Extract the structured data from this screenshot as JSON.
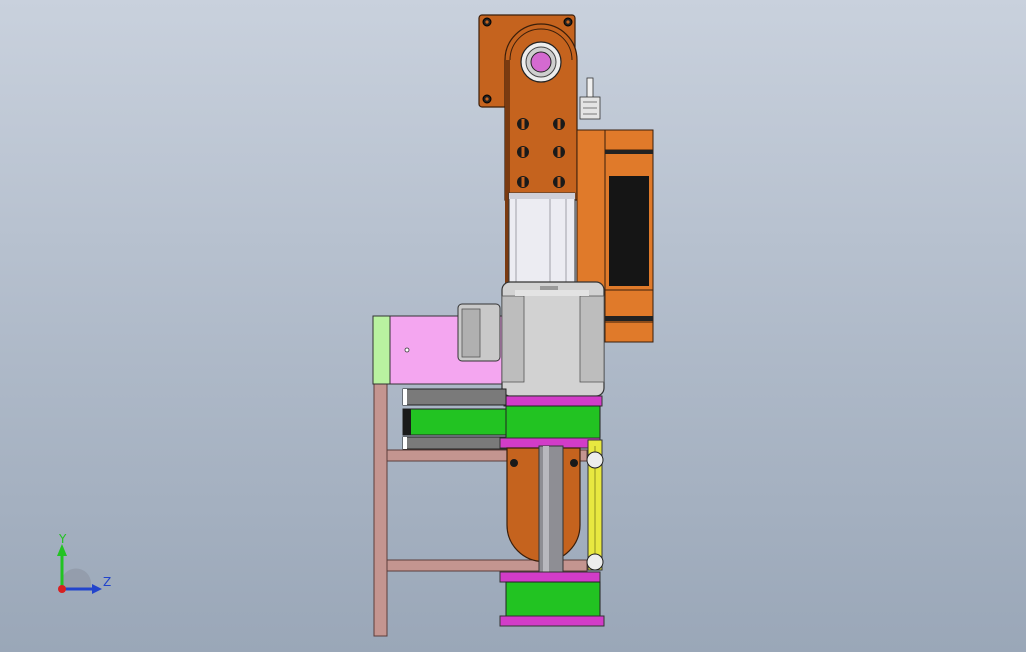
{
  "viewport": {
    "background_top": "#c9d1dd",
    "background_bottom": "#9aa7b8"
  },
  "axes": {
    "y_label": "Y",
    "z_label": "Z",
    "y_color": "#22c322",
    "z_color": "#2244cc",
    "origin_color": "#d82020"
  },
  "colors": {
    "bracket_brown": "#c5631e",
    "bracket_orange": "#e07a2a",
    "motor_body": "#d2d2d2",
    "motor_white": "#ececf2",
    "magenta_box": "#f4a6f0",
    "frame_pink": "#c49590",
    "light_green": "#b9f2a0",
    "gear_green": "#22c322",
    "purple_ring": "#d23cc8",
    "shaft_gray": "#8e8e94",
    "link_yellow": "#e8e840",
    "dark_strip": "#222222"
  }
}
